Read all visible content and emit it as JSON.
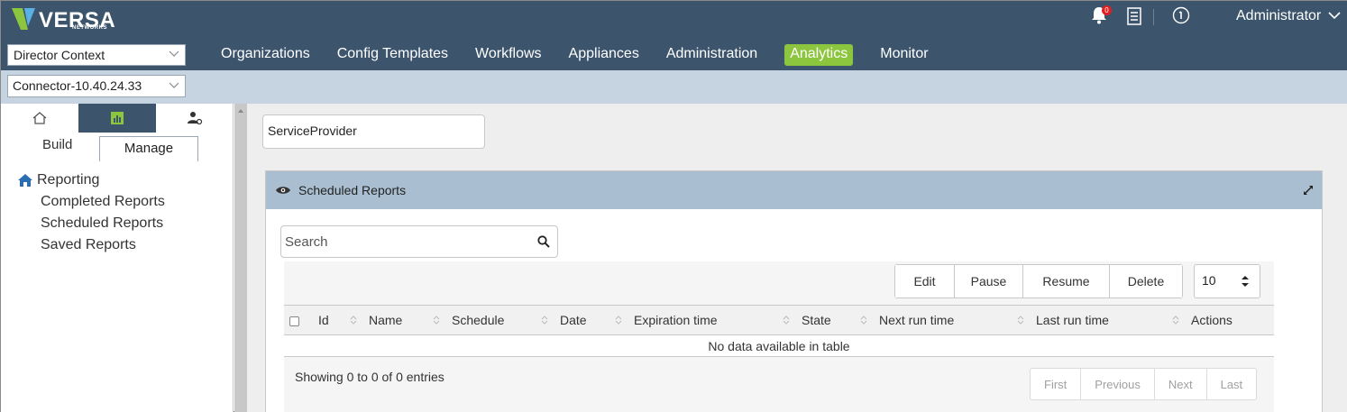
{
  "brand": {
    "name": "VERSA",
    "sub": "NETWORKS"
  },
  "header": {
    "context_select": "Director Context",
    "nav": [
      "Organizations",
      "Config Templates",
      "Workflows",
      "Appliances",
      "Administration",
      "Analytics",
      "Monitor"
    ],
    "active_nav": "Analytics",
    "notification_count": "0",
    "user": "Administrator"
  },
  "subbar": {
    "connector_select": "Connector-10.40.24.33"
  },
  "left_panel": {
    "subtabs": {
      "build": "Build",
      "manage": "Manage"
    },
    "tree_root": "Reporting",
    "tree_items": [
      "Completed Reports",
      "Scheduled Reports",
      "Saved Reports"
    ]
  },
  "main": {
    "organization": "ServiceProvider",
    "panel_title": "Scheduled Reports",
    "search_placeholder": "Search",
    "buttons": {
      "edit": "Edit",
      "pause": "Pause",
      "resume": "Resume",
      "delete": "Delete"
    },
    "page_size": "10",
    "columns": [
      "Id",
      "Name",
      "Schedule",
      "Date",
      "Expiration time",
      "State",
      "Next run time",
      "Last run time",
      "Actions"
    ],
    "empty_message": "No data available in table",
    "showing": "Showing 0 to 0 of 0 entries",
    "pager": {
      "first": "First",
      "previous": "Previous",
      "next": "Next",
      "last": "Last"
    }
  },
  "colors": {
    "header_bg": "#3c546c",
    "subbar_bg": "#c5d4e0",
    "active_nav": "#8cc63f",
    "panel_head": "#a9bfd1",
    "badge": "#e02020"
  }
}
